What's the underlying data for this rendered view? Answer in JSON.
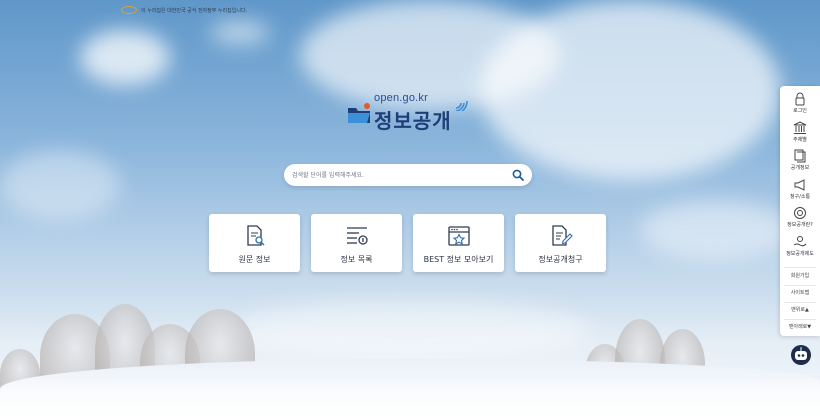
{
  "gov_banner": {
    "text": "이 누리집은 대한민국 공식 전자정부 누리집입니다."
  },
  "logo": {
    "domain": "open.go.kr",
    "name": "정보공개"
  },
  "search": {
    "placeholder": "검색할 단어를 입력해주세요."
  },
  "cards": [
    {
      "label": "원문 정보",
      "icon": "document-search-icon"
    },
    {
      "label": "정보 목록",
      "icon": "list-info-icon"
    },
    {
      "label": "BEST 정보 모아보기",
      "icon": "browser-star-icon"
    },
    {
      "label": "정보공개청구",
      "icon": "document-edit-icon"
    }
  ],
  "side_menu": {
    "items": [
      {
        "label": "로그인",
        "icon": "lock-icon"
      },
      {
        "label": "주제별",
        "icon": "building-icon"
      },
      {
        "label": "공개정보",
        "icon": "files-icon"
      },
      {
        "label": "청구/소통",
        "icon": "megaphone-icon"
      },
      {
        "label": "정보공개란?",
        "icon": "target-icon"
      },
      {
        "label": "정보공개제도",
        "icon": "hand-icon"
      }
    ],
    "links": [
      "회원가입",
      "사이트맵",
      "맨위로▲",
      "맨아래로▼"
    ]
  },
  "colors": {
    "brand_navy": "#1f3e78",
    "search_icon": "#1d5b9a",
    "card_icon": "#2e3d52"
  }
}
